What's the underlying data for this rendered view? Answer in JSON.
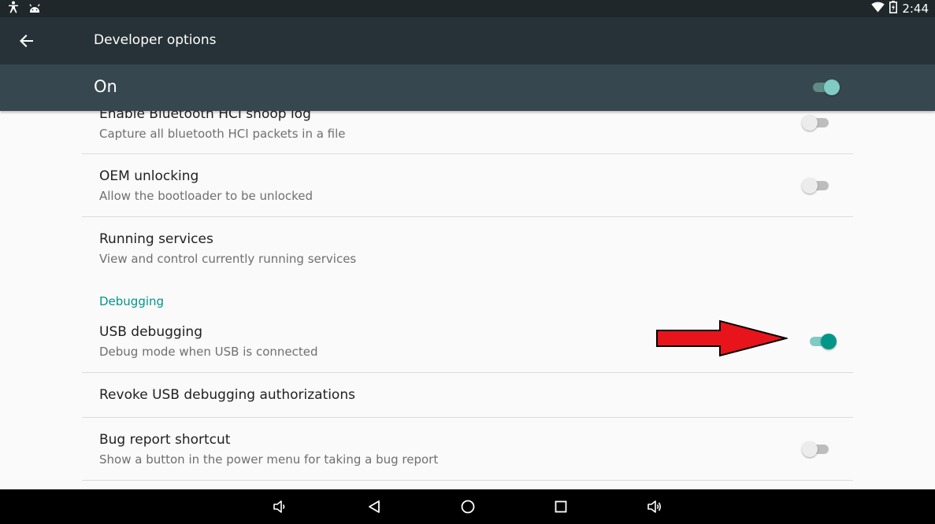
{
  "status_bar": {
    "time": "2:44",
    "left_icons": [
      "accessibility-icon",
      "android-icon"
    ],
    "right_icons": [
      "wifi-icon",
      "battery-icon"
    ]
  },
  "toolbar": {
    "title": "Developer options",
    "back_icon": "arrow-back-icon"
  },
  "master_switch": {
    "label": "On",
    "state": "on"
  },
  "settings": {
    "bt_hci": {
      "title": "Enable Bluetooth HCI snoop log",
      "summary": "Capture all bluetooth HCI packets in a file",
      "switch": "off"
    },
    "oem_unlocking": {
      "title": "OEM unlocking",
      "summary": "Allow the bootloader to be unlocked",
      "switch": "off"
    },
    "running_services": {
      "title": "Running services",
      "summary": "View and control currently running services"
    },
    "debugging_category": "Debugging",
    "usb_debugging": {
      "title": "USB debugging",
      "summary": "Debug mode when USB is connected",
      "switch": "on"
    },
    "revoke_usb": {
      "title": "Revoke USB debugging authorizations"
    },
    "bug_report": {
      "title": "Bug report shortcut",
      "summary": "Show a button in the power menu for taking a bug report",
      "switch": "off"
    }
  },
  "annotation": {
    "arrow_color": "#e8141c",
    "points_to": "usb-debugging-switch"
  },
  "nav_bar": {
    "buttons": [
      "volume-down-icon",
      "back-triangle-icon",
      "home-circle-icon",
      "recents-square-icon",
      "volume-up-icon"
    ]
  },
  "colors": {
    "accent": "#009688",
    "toolbar": "#263238",
    "master_bar": "#37474f"
  }
}
